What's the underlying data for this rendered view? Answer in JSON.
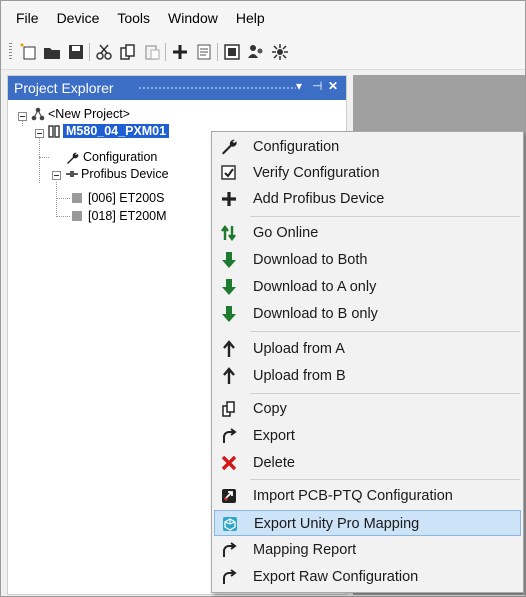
{
  "menubar": {
    "items": [
      "File",
      "Device",
      "Tools",
      "Window",
      "Help"
    ]
  },
  "toolbar": {
    "buttons": [
      "new-project-icon",
      "open-icon",
      "save-icon",
      "cut-icon",
      "copy-icon",
      "paste-icon",
      "add-icon",
      "properties-icon",
      "window-icon",
      "users-icon",
      "network-icon"
    ]
  },
  "explorer": {
    "title": "Project Explorer",
    "pin": "▾ ⊣ ✕",
    "tree": {
      "project": "<New Project>",
      "device": "M580_04_PXM01",
      "configuration": "Configuration",
      "profibus": "Profibus Device",
      "slave1": "[006] ET200S",
      "slave2": "[018] ET200M"
    }
  },
  "context_menu": {
    "items": [
      {
        "label": "Configuration",
        "icon": "wrench-icon"
      },
      {
        "label": "Verify Configuration",
        "icon": "checkbox-icon"
      },
      {
        "label": "Add Profibus Device",
        "icon": "plus-icon"
      },
      {
        "label": "Go Online",
        "icon": "go-online-icon"
      },
      {
        "label": "Download to Both",
        "icon": "download-arrow-icon"
      },
      {
        "label": "Download to A only",
        "icon": "download-arrow-icon"
      },
      {
        "label": "Download to B only",
        "icon": "download-arrow-icon"
      },
      {
        "label": "Upload from A",
        "icon": "upload-arrow-icon"
      },
      {
        "label": "Upload from B",
        "icon": "upload-arrow-icon"
      },
      {
        "label": "Copy",
        "icon": "copy-icon"
      },
      {
        "label": "Export",
        "icon": "export-icon"
      },
      {
        "label": "Delete",
        "icon": "delete-x-icon"
      },
      {
        "label": "Import PCB-PTQ Configuration",
        "icon": "import-icon"
      },
      {
        "label": "Export Unity Pro Mapping",
        "icon": "unity-icon"
      },
      {
        "label": "Mapping Report",
        "icon": "export-icon"
      },
      {
        "label": "Export Raw Configuration",
        "icon": "export-icon"
      }
    ],
    "highlighted_index": 13,
    "colors": {
      "green": "#1e7a2e",
      "red": "#d01818",
      "highlight": "#cde3f7"
    }
  }
}
